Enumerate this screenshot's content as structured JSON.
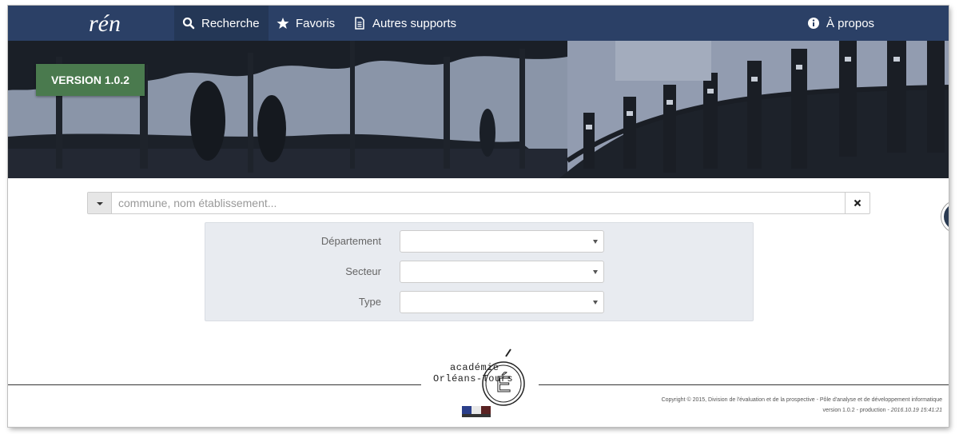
{
  "navbar": {
    "brand": "rén",
    "items": [
      {
        "label": "Recherche",
        "icon": "search-icon"
      },
      {
        "label": "Favoris",
        "icon": "star-icon"
      },
      {
        "label": "Autres supports",
        "icon": "document-icon"
      }
    ],
    "about": {
      "label": "À propos",
      "icon": "info-icon"
    }
  },
  "banner": {
    "version_badge": "VERSION 1.0.2"
  },
  "search": {
    "placeholder": "commune, nom établissement...",
    "value": "",
    "clear_icon": "close-icon",
    "toggle_icon": "caret-down-icon"
  },
  "filters": [
    {
      "label": "Département",
      "value": ""
    },
    {
      "label": "Secteur",
      "value": ""
    },
    {
      "label": "Type",
      "value": ""
    }
  ],
  "footer": {
    "logo_line1": "académie",
    "logo_line2": "Orléans-Tours",
    "logo_letter": "É",
    "copyright": "Copyright © 2015, Division de l'évaluation et de la prospective - Pôle d'analyse et de développement informatique",
    "version_prefix": "version 1.0.2  - production - ",
    "version_timestamp": "2016.10.19 15:41:21"
  },
  "colors": {
    "navbar_bg": "#2b4066",
    "badge_bg": "#4a7a4e",
    "filters_bg": "#e8ebf0"
  }
}
